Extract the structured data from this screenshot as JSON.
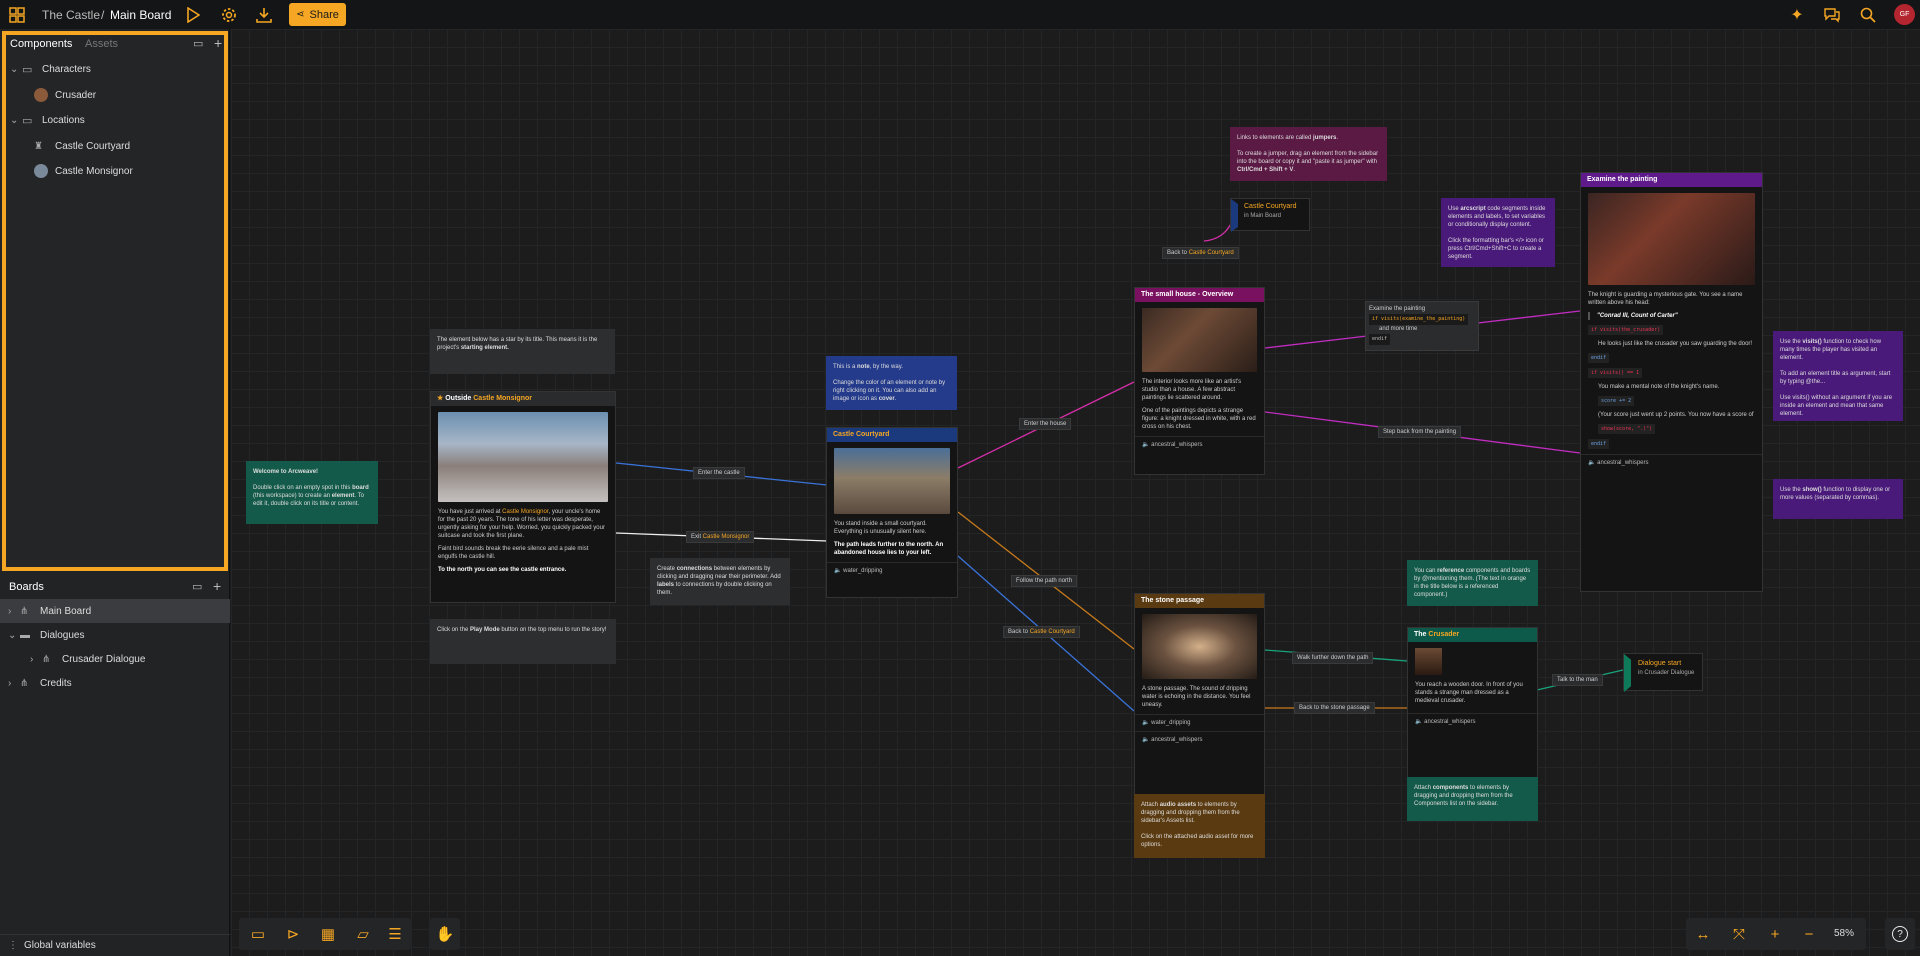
{
  "topbar": {
    "project": "The Castle",
    "sep": "/",
    "board": "Main Board",
    "share": "Share",
    "avatar": "GF"
  },
  "sidebar": {
    "components_tab": "Components",
    "assets_tab": "Assets",
    "tree": [
      {
        "label": "Characters",
        "type": "folder"
      },
      {
        "label": "Crusader",
        "type": "item"
      },
      {
        "label": "Locations",
        "type": "folder"
      },
      {
        "label": "Castle Courtyard",
        "type": "item"
      },
      {
        "label": "Castle Monsignor",
        "type": "item"
      }
    ],
    "boards_title": "Boards",
    "boards": [
      {
        "label": "Main Board"
      },
      {
        "label": "Dialogues"
      },
      {
        "label": "Crusader Dialogue"
      },
      {
        "label": "Credits"
      }
    ],
    "global_vars": "Global variables"
  },
  "canvas": {
    "zoom": "58%",
    "note_start": {
      "pre": "The element below has a star by its title. This means it is the project's ",
      "b": "starting element."
    },
    "outside": {
      "title_pre": "Outside ",
      "title_hl": "Castle Monsignor",
      "p1a": "You have just arrived at ",
      "p1hl": "Castle Monsignor",
      "p1b": ", your uncle's home for the past 20 years. The tone of his letter was desperate, urgently asking for your help. Worried, you quickly packed your suitcase and took the first plane.",
      "p2": "Faint bird sounds break the eerie silence and a pale mist engulfs the castle hill.",
      "p3": "To the north you can see the castle entrance."
    },
    "note_play": {
      "pre": "Click on the ",
      "b": "Play Mode",
      "post": " button on the top menu to run the story!"
    },
    "welcome": {
      "title": "Welcome to Arcweave!",
      "body1": "Double click on an empty spot in this ",
      "b1": "board",
      "body2": " (this workspace) to create an ",
      "b2": "element",
      "body3": ". To edit it, double click on its title or content."
    },
    "note_connections": {
      "pre": "Create ",
      "b1": "connections",
      "mid": " between elements by clicking and dragging near their perimeter. Add ",
      "b2": "labels",
      "post": " to connections by double clicking on them."
    },
    "note_color": {
      "pre": "This is a ",
      "b": "note",
      "mid": ", by the way.",
      "p2a": "Change the color of an element or note by right clicking on it. You can also add an image or icon as ",
      "b2": "cover",
      "p2b": "."
    },
    "courtyard": {
      "title": "Castle Courtyard",
      "p1": "You stand inside a small courtyard. Everything is unusually silent here.",
      "p2": "The path leads further to the north. An abandoned house lies to your left.",
      "audio": "water_dripping"
    },
    "small_house": {
      "title": "The small house - Overview",
      "p1": "The interior looks more like an artist's studio than a house. A few abstract paintings lie scattered around.",
      "p2": "One of the paintings depicts a strange figure: a knight dressed in white, with a red cross on his chest.",
      "audio": "ancestral_whispers"
    },
    "stone_passage": {
      "title": "The stone passage",
      "p1": "A stone passage. The sound of dripping water is echoing in the distance. You feel uneasy.",
      "audio1": "water_dripping",
      "audio2": "ancestral_whispers"
    },
    "crusader": {
      "title_pre": "The ",
      "title_hl": "Crusader",
      "p1": "You reach a wooden door. In front of you stands a strange man dressed as a medieval crusader.",
      "audio": "ancestral_whispers"
    },
    "painting": {
      "title": "Examine the painting",
      "p1": "The knight is guarding a mysterious gate. You see a name written above his head:",
      "quote": "\"Conrad III, Count of Carter\"",
      "if1": "if visits(the_crusader)",
      "p2": "He looks just like the crusader you saw guarding the door!",
      "endif1": "endif",
      "if2": "if visits() == 1",
      "p3": "You make a mental note of the knight's name.",
      "score": "score += 2",
      "p4": "(Your score just went up 2 points. You now have a score of",
      "show": "show(score, \".)\")",
      "endif2": "endif",
      "audio": "ancestral_whispers"
    },
    "jumper_note": {
      "pre": "Links to elements are called ",
      "b1": "jumpers",
      "mid": ".",
      "p2a": "To create a jumper, drag an element from the sidebar into the board or copy it and \"paste it as jumper\" with ",
      "b2": "Ctrl/Cmd + Shift + V",
      "p2b": "."
    },
    "jumper_cy": {
      "title": "Castle Courtyard",
      "sub": "in Main Board"
    },
    "arcscript_note": {
      "pre": "Use ",
      "b1": "arcscript",
      "mid": " code segments inside elements and labels, to set variables or conditionally display content.",
      "p2": "Click the formatting bar's </> icon or press Ctrl/Cmd+Shift+C to create a segment."
    },
    "cond_label": {
      "l1": "Examine the painting",
      "code": "if visits(examine_the_painting)",
      "l2": "and more time",
      "l3": "endif"
    },
    "visits_note": {
      "p1a": "Use the ",
      "b1": "visits()",
      "p1b": " function to check how many times the player has visited an element.",
      "p2": "To add an element title as argument, start by typing @the...",
      "p3": "Use visits() without an argument if you are inside an element and mean that same element."
    },
    "show_note": {
      "pre": "Use the ",
      "b": "show()",
      "post": " function to display one or more values (separated by commas)."
    },
    "ref_note": {
      "pre": "You can ",
      "b": "reference",
      "post": " components and boards by @mentioning them. (The text in orange in the title below is a referenced component.)"
    },
    "attach_note": {
      "pre": "Attach ",
      "b": "components",
      "post": " to elements by dragging and dropping them from the Components list on the sidebar."
    },
    "audio_note": {
      "pre": "Attach ",
      "b": "audio assets",
      "post": " to elements by dragging and dropping them from the sidebar's Assets list.",
      "p2": "Click on the attached audio asset for more options."
    },
    "dialogue_jumper": {
      "title": "Dialogue start",
      "sub": "in Crusader Dialogue"
    },
    "labels": {
      "enter_castle": "Enter the castle",
      "exit_pre": "Exit ",
      "exit_hl": "Castle Monsignor",
      "enter_house": "Enter the house",
      "back_pre": "Back to ",
      "back_hl": "Castle Courtyard",
      "follow": "Follow the path north",
      "back2_pre": "Back to ",
      "back2_hl": "Castle Courtyard",
      "step_back": "Step back from the painting",
      "walk": "Walk further down the path",
      "back_stone": "Back to the stone passage",
      "talk": "Talk to the man"
    }
  }
}
